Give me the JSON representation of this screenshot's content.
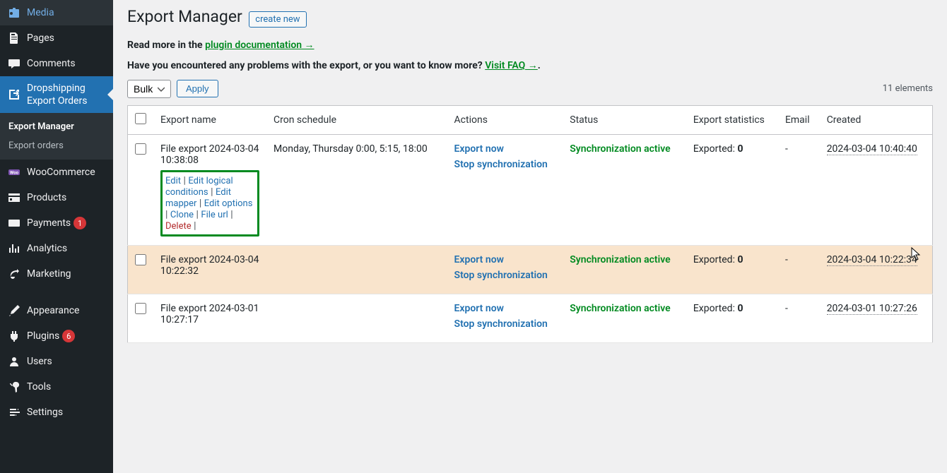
{
  "sidebar": {
    "items": [
      {
        "label": "Media",
        "icon": "media"
      },
      {
        "label": "Pages",
        "icon": "pages"
      },
      {
        "label": "Comments",
        "icon": "comments"
      },
      {
        "label": "Dropshipping Export Orders",
        "icon": "export",
        "active": true
      },
      {
        "label": "WooCommerce",
        "icon": "woo"
      },
      {
        "label": "Products",
        "icon": "products"
      },
      {
        "label": "Payments",
        "icon": "payments",
        "badge": "1"
      },
      {
        "label": "Analytics",
        "icon": "analytics"
      },
      {
        "label": "Marketing",
        "icon": "marketing"
      },
      {
        "label": "Appearance",
        "icon": "appearance"
      },
      {
        "label": "Plugins",
        "icon": "plugins",
        "badge": "6"
      },
      {
        "label": "Users",
        "icon": "users"
      },
      {
        "label": "Tools",
        "icon": "tools"
      },
      {
        "label": "Settings",
        "icon": "settings"
      }
    ],
    "submenu": [
      {
        "label": "Export Manager",
        "active": true
      },
      {
        "label": "Export orders",
        "active": false
      }
    ]
  },
  "header": {
    "title": "Export Manager",
    "create_btn": "create new",
    "intro1_prefix": "Read more in the ",
    "intro1_link": "plugin documentation →",
    "intro2_prefix": "Have you encountered any problems with the export, or you want to know more? ",
    "intro2_link": "Visit FAQ →",
    "intro2_suffix": "."
  },
  "toolbar": {
    "bulk_label": "Bulk",
    "apply_label": "Apply",
    "count_label": "11 elements"
  },
  "table": {
    "headers": {
      "name": "Export name",
      "cron": "Cron schedule",
      "actions": "Actions",
      "status": "Status",
      "stats": "Export statistics",
      "email": "Email",
      "created": "Created"
    },
    "row_actions": {
      "edit": "Edit",
      "edit_logical": "Edit logical conditions",
      "edit_mapper": "Edit mapper",
      "edit_options": "Edit options",
      "clone": "Clone",
      "file_url": "File url",
      "delete": "Delete"
    },
    "action_links": {
      "export_now": "Export now",
      "stop_sync": "Stop synchronization"
    },
    "rows": [
      {
        "name": "File export 2024-03-04 10:38:08",
        "cron": "Monday, Thursday 0:00, 5:15, 18:00",
        "status": "Synchronization active",
        "stats_label": "Exported: ",
        "stats_value": "0",
        "email": "-",
        "created": "2024-03-04 10:40:40",
        "show_actions": true,
        "highlighted": false
      },
      {
        "name": "File export 2024-03-04 10:22:32",
        "cron": "",
        "status": "Synchronization active",
        "stats_label": "Exported: ",
        "stats_value": "0",
        "email": "-",
        "created": "2024-03-04 10:22:34",
        "show_actions": false,
        "highlighted": true
      },
      {
        "name": "File export 2024-03-01 10:27:17",
        "cron": "",
        "status": "Synchronization active",
        "stats_label": "Exported: ",
        "stats_value": "0",
        "email": "-",
        "created": "2024-03-01 10:27:26",
        "show_actions": false,
        "highlighted": false
      }
    ]
  }
}
